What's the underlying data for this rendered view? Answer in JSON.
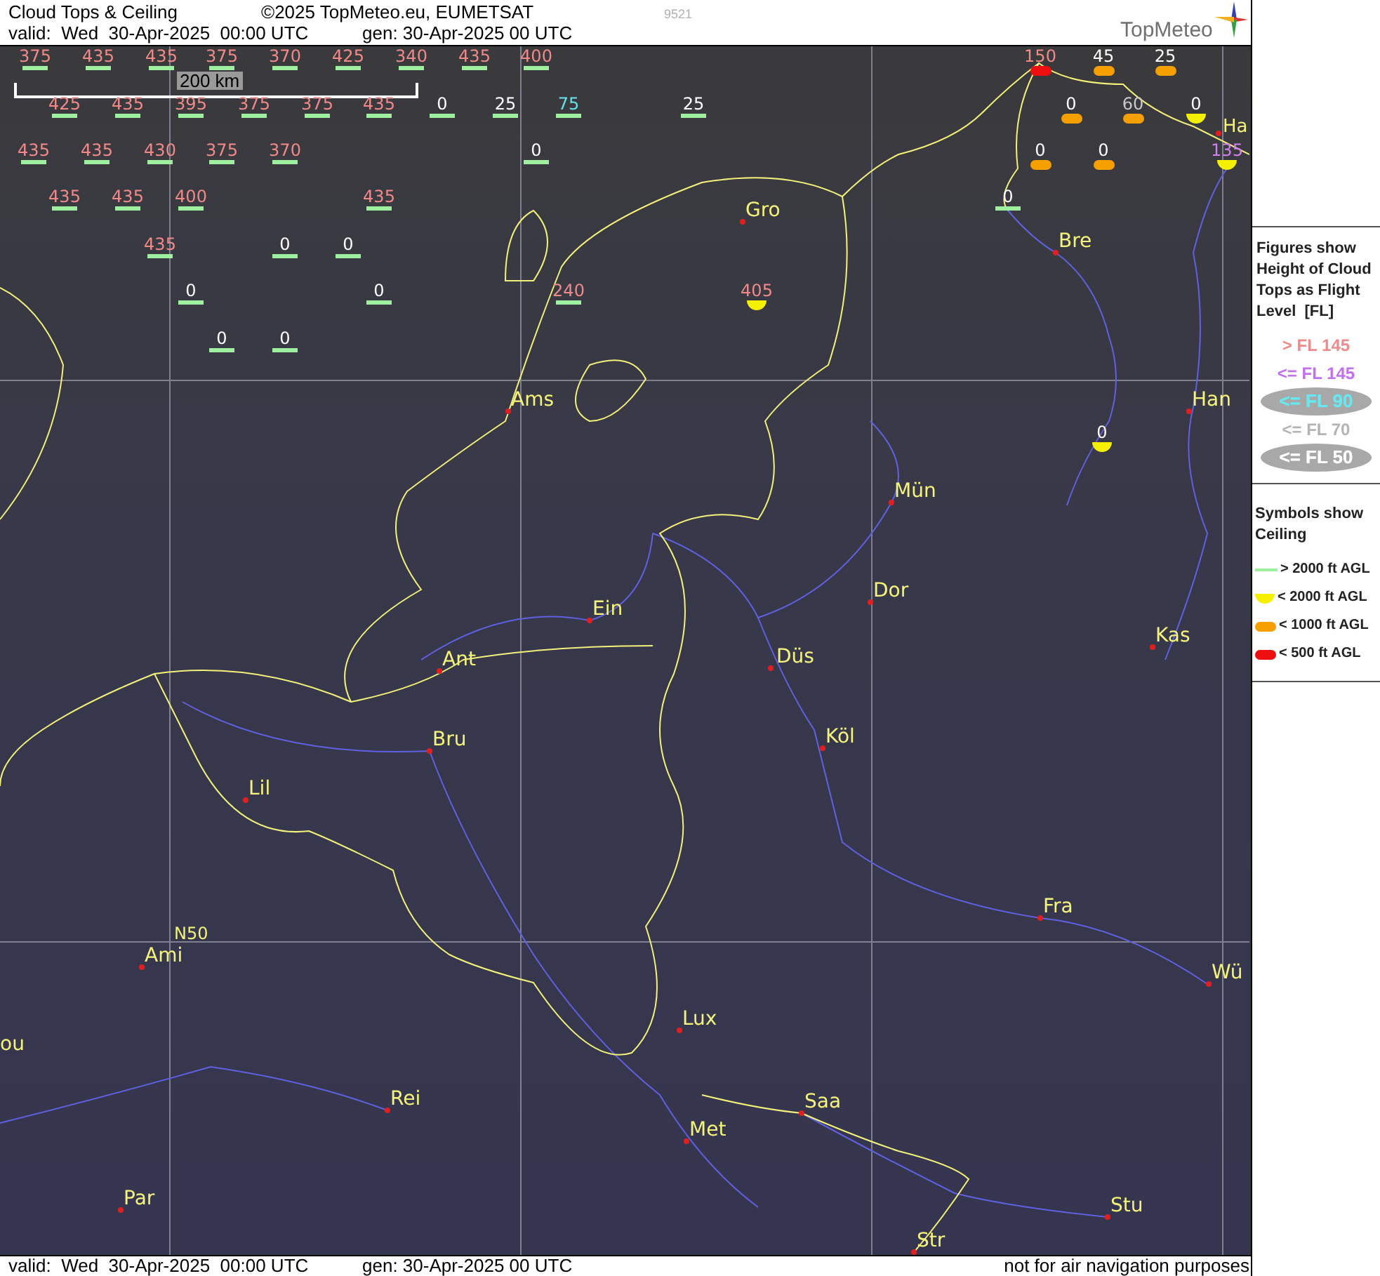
{
  "header": {
    "title": "Cloud Tops & Ceiling",
    "copyright": "©2025 TopMeteo.eu, EUMETSAT",
    "code": "9521",
    "valid": "valid:  Wed  30-Apr-2025  00:00 UTC",
    "generated": "gen: 30-Apr-2025 00 UTC",
    "logo": "TopMeteo"
  },
  "map": {
    "scale_label": "200 km",
    "stations": [
      {
        "value": "375",
        "color": "#f08a8a",
        "kind": "above_2000"
      },
      {
        "value": "435",
        "color": "#f08a8a",
        "kind": "above_2000"
      },
      {
        "value": "435",
        "color": "#f08a8a",
        "kind": "above_2000"
      },
      {
        "value": "375",
        "color": "#f08a8a",
        "kind": "above_2000"
      },
      {
        "value": "370",
        "color": "#f08a8a",
        "kind": "above_2000"
      },
      {
        "value": "425",
        "color": "#f08a8a",
        "kind": "above_2000"
      },
      {
        "value": "340",
        "color": "#f08a8a",
        "kind": "above_2000"
      },
      {
        "value": "435",
        "color": "#f08a8a",
        "kind": "above_2000"
      },
      {
        "value": "400",
        "color": "#f08a8a",
        "kind": "above_2000"
      },
      {
        "value": "425",
        "color": "#f08a8a",
        "kind": "above_2000"
      },
      {
        "value": "435",
        "color": "#f08a8a",
        "kind": "above_2000"
      },
      {
        "value": "395",
        "color": "#f08a8a",
        "kind": "above_2000"
      },
      {
        "value": "375",
        "color": "#f08a8a",
        "kind": "above_2000"
      },
      {
        "value": "375",
        "color": "#f08a8a",
        "kind": "above_2000"
      },
      {
        "value": "435",
        "color": "#f08a8a",
        "kind": "above_2000"
      },
      {
        "value": "0",
        "color": "#ffffff",
        "kind": "above_2000"
      },
      {
        "value": "25",
        "color": "#ffffff",
        "kind": "above_2000"
      },
      {
        "value": "75",
        "color": "#66e0e8",
        "kind": "above_2000"
      },
      {
        "value": "25",
        "color": "#ffffff",
        "kind": "above_2000"
      },
      {
        "value": "435",
        "color": "#f08a8a",
        "kind": "above_2000"
      },
      {
        "value": "435",
        "color": "#f08a8a",
        "kind": "above_2000"
      },
      {
        "value": "430",
        "color": "#f08a8a",
        "kind": "above_2000"
      },
      {
        "value": "375",
        "color": "#f08a8a",
        "kind": "above_2000"
      },
      {
        "value": "370",
        "color": "#f08a8a",
        "kind": "above_2000"
      },
      {
        "value": "0",
        "color": "#ffffff",
        "kind": "above_2000"
      },
      {
        "value": "435",
        "color": "#f08a8a",
        "kind": "above_2000"
      },
      {
        "value": "435",
        "color": "#f08a8a",
        "kind": "above_2000"
      },
      {
        "value": "400",
        "color": "#f08a8a",
        "kind": "above_2000"
      },
      {
        "value": "435",
        "color": "#f08a8a",
        "kind": "above_2000"
      },
      {
        "value": "435",
        "color": "#f08a8a",
        "kind": "above_2000"
      },
      {
        "value": "0",
        "color": "#ffffff",
        "kind": "above_2000"
      },
      {
        "value": "0",
        "color": "#ffffff",
        "kind": "above_2000"
      },
      {
        "value": "0",
        "color": "#ffffff",
        "kind": "above_2000"
      },
      {
        "value": "0",
        "color": "#ffffff",
        "kind": "above_2000"
      },
      {
        "value": "240",
        "color": "#f08a8a",
        "kind": "above_2000"
      },
      {
        "value": "405",
        "color": "#f08a8a",
        "kind": "below_2000"
      },
      {
        "value": "0",
        "color": "#ffffff",
        "kind": "above_2000"
      },
      {
        "value": "0",
        "color": "#ffffff",
        "kind": "above_2000"
      },
      {
        "value": "150",
        "color": "#f08a8a",
        "kind": "below_500"
      },
      {
        "value": "45",
        "color": "#ffffff",
        "kind": "below_1000"
      },
      {
        "value": "25",
        "color": "#ffffff",
        "kind": "below_1000"
      },
      {
        "value": "0",
        "color": "#ffffff",
        "kind": "below_1000"
      },
      {
        "value": "60",
        "color": "#c8c8c8",
        "kind": "below_1000"
      },
      {
        "value": "0",
        "color": "#ffffff",
        "kind": "below_2000"
      },
      {
        "value": "0",
        "color": "#ffffff",
        "kind": "below_1000"
      },
      {
        "value": "0",
        "color": "#ffffff",
        "kind": "below_1000"
      },
      {
        "value": "135",
        "color": "#d080f0",
        "kind": "below_2000"
      },
      {
        "value": "0",
        "color": "#ffffff",
        "kind": "above_2000"
      },
      {
        "value": "0",
        "color": "#ffffff",
        "kind": "below_2000"
      }
    ],
    "cities": [
      {
        "name": "Gro"
      },
      {
        "name": "Bre"
      },
      {
        "name": "Ha"
      },
      {
        "name": "Ams"
      },
      {
        "name": "Han"
      },
      {
        "name": "Mün"
      },
      {
        "name": "Ein"
      },
      {
        "name": "Dor"
      },
      {
        "name": "Ant"
      },
      {
        "name": "Düs"
      },
      {
        "name": "Kas"
      },
      {
        "name": "Bru"
      },
      {
        "name": "Köl"
      },
      {
        "name": "Lil"
      },
      {
        "name": "Fra"
      },
      {
        "name": "Ami"
      },
      {
        "name": "Wü"
      },
      {
        "name": "Lux"
      },
      {
        "name": "ou"
      },
      {
        "name": "Rei"
      },
      {
        "name": "Saa"
      },
      {
        "name": "Met"
      },
      {
        "name": "Par"
      },
      {
        "name": "Stu"
      },
      {
        "name": "Str"
      }
    ],
    "grid_label": "N50"
  },
  "legend": {
    "figures_title": "Figures show Height of Cloud Tops as Flight Level  [FL]",
    "figures": [
      {
        "label": "> FL 145",
        "color": "#f08a8a",
        "highlighted": false
      },
      {
        "label": "<= FL 145",
        "color": "#c070f0",
        "highlighted": false
      },
      {
        "label": "<= FL 90",
        "color": "#66e8f0",
        "highlighted": true
      },
      {
        "label": "<= FL 70",
        "color": "#b4b4b4",
        "highlighted": false
      },
      {
        "label": "<= FL 50",
        "color": "#ffffff",
        "highlighted": true
      }
    ],
    "symbols_title": "Symbols show Ceiling",
    "symbols": [
      {
        "label": "> 2000 ft AGL",
        "kind": "above_2000"
      },
      {
        "label": "< 2000 ft AGL",
        "kind": "below_2000"
      },
      {
        "label": "< 1000 ft AGL",
        "kind": "below_1000"
      },
      {
        "label": "< 500 ft AGL",
        "kind": "below_500"
      }
    ]
  },
  "footer": {
    "valid": "valid:  Wed  30-Apr-2025  00:00 UTC",
    "generated": "gen: 30-Apr-2025 00 UTC",
    "notice": "not for air navigation purposes"
  }
}
